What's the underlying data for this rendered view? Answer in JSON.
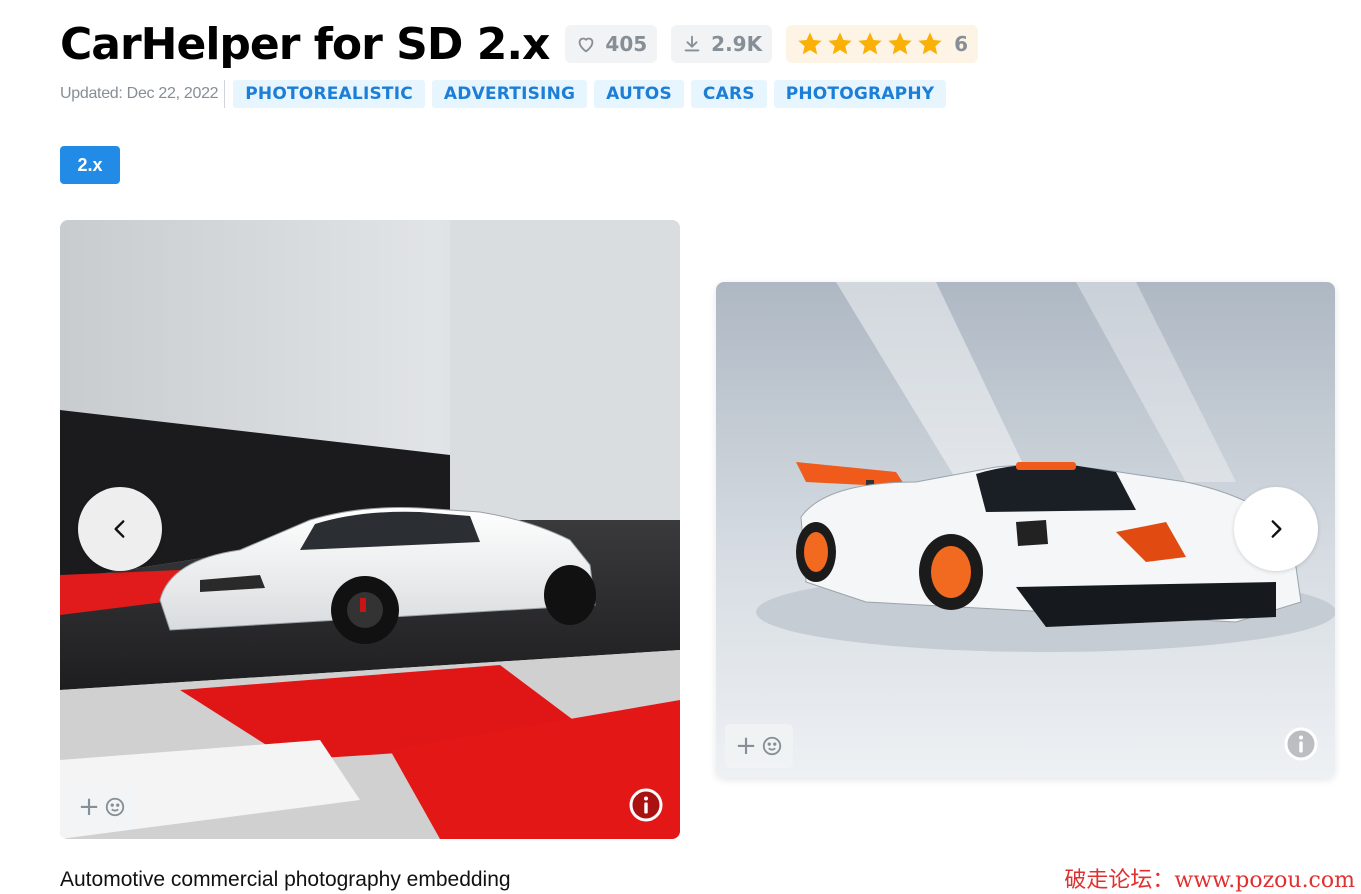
{
  "model": {
    "title": "CarHelper for SD 2.x",
    "likes": "405",
    "downloads": "2.9K",
    "rating_stars": 5,
    "rating_count": "6"
  },
  "meta": {
    "updated": "Updated: Dec 22, 2022",
    "tags": [
      "PHOTOREALISTIC",
      "ADVERTISING",
      "AUTOS",
      "CARS",
      "PHOTOGRAPHY"
    ]
  },
  "version": {
    "label": "2.x"
  },
  "gallery": {
    "add_reaction_label": "+"
  },
  "description": {
    "text": "Automotive commercial photography embedding"
  },
  "watermark": "破走论坛：www.pozou.com",
  "icons": {
    "like": "heart-icon",
    "download": "download-icon",
    "star": "star-icon",
    "reaction": "smile-icon",
    "info": "info-icon",
    "prev": "chevron-left-icon",
    "next": "chevron-right-icon"
  },
  "colors": {
    "tag_bg": "#e7f5ff",
    "tag_text": "#1c7ed6",
    "badge_bg": "#228be6",
    "star": "#fab005",
    "watermark": "#e03131"
  }
}
